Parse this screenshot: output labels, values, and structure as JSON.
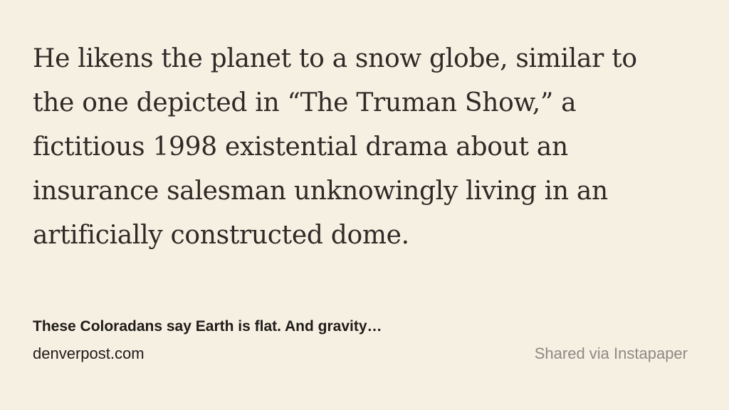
{
  "quote": {
    "lines": [
      "He likens the planet to a snow globe, similar to",
      "the one depicted in “The Truman Show,” a",
      "fictitious 1998 existential drama about an",
      "insurance salesman unknowingly living in an",
      "artificially constructed dome."
    ]
  },
  "source": {
    "title": "These Coloradans say Earth is flat. And gravity…",
    "domain": "denverpost.com"
  },
  "footer": {
    "shared_via": "Shared via Instapaper"
  },
  "colors": {
    "background": "#f6f0e3",
    "text": "#2e2a26",
    "muted": "#8e8a84"
  }
}
